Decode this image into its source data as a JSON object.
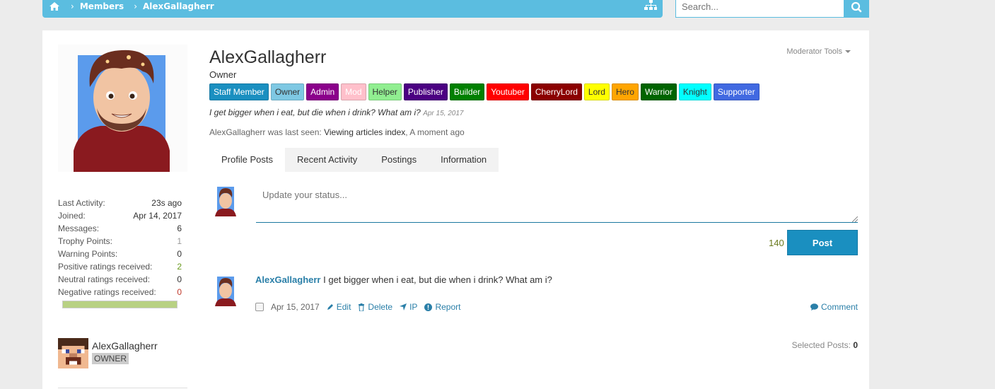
{
  "nav": {
    "breadcrumb": [
      "Members",
      "AlexGallagherr"
    ]
  },
  "search": {
    "placeholder": "Search..."
  },
  "profile": {
    "name": "AlexGallagherr",
    "title": "Owner",
    "moderator_tools": "Moderator Tools",
    "badges": [
      {
        "label": "Staff Member",
        "color": "#1a8fc0",
        "text": "#ffffff"
      },
      {
        "label": "Owner",
        "color": "#7ec8e3",
        "text": "#333333"
      },
      {
        "label": "Admin",
        "color": "#8b008b",
        "text": "#ffffff"
      },
      {
        "label": "Mod",
        "color": "#ffc0cb",
        "text": "#ffffff"
      },
      {
        "label": "Helper",
        "color": "#90ee90",
        "text": "#333333"
      },
      {
        "label": "Publisher",
        "color": "#4b0082",
        "text": "#ffffff"
      },
      {
        "label": "Builder",
        "color": "#008000",
        "text": "#ffffff"
      },
      {
        "label": "Youtuber",
        "color": "#ff0000",
        "text": "#ffffff"
      },
      {
        "label": "CherryLord",
        "color": "#8b0000",
        "text": "#ffffff"
      },
      {
        "label": "Lord",
        "color": "#ffff00",
        "text": "#333333"
      },
      {
        "label": "Hero",
        "color": "#ffa500",
        "text": "#333333"
      },
      {
        "label": "Warrior",
        "color": "#006400",
        "text": "#ffffff"
      },
      {
        "label": "Knight",
        "color": "#00ffff",
        "text": "#333333"
      },
      {
        "label": "Supporter",
        "color": "#4169e1",
        "text": "#ffffff"
      }
    ],
    "status": "I get bigger when i eat, but die when i drink? What am i?",
    "status_date": "Apr 15, 2017",
    "last_seen_prefix": "AlexGallagherr was last seen:",
    "last_seen_activity": "Viewing articles index",
    "last_seen_time": "A moment ago"
  },
  "tabs": [
    "Profile Posts",
    "Recent Activity",
    "Postings",
    "Information"
  ],
  "stats": [
    {
      "label": "Last Activity:",
      "value": "23s ago",
      "style": ""
    },
    {
      "label": "Joined:",
      "value": "Apr 14, 2017",
      "style": ""
    },
    {
      "label": "Messages:",
      "value": "6",
      "style": ""
    },
    {
      "label": "Trophy Points:",
      "value": "1",
      "style": "muted"
    },
    {
      "label": "Warning Points:",
      "value": "0",
      "style": ""
    },
    {
      "label": "Positive ratings received:",
      "value": "2",
      "style": "pos"
    },
    {
      "label": "Neutral ratings received:",
      "value": "0",
      "style": ""
    },
    {
      "label": "Negative ratings received:",
      "value": "0",
      "style": "neg"
    }
  ],
  "mini_user": {
    "name": "AlexGallagherr",
    "rank": "OWNER"
  },
  "status_box": {
    "placeholder": "Update your status...",
    "counter": "140",
    "post_label": "Post"
  },
  "post": {
    "author": "AlexGallagherr",
    "text": "I get bigger when i eat, but die when i drink? What am i?",
    "date": "Apr 15, 2017",
    "edit": "Edit",
    "delete": "Delete",
    "ip": "IP",
    "report": "Report",
    "comment": "Comment"
  },
  "selected_posts": {
    "label": "Selected Posts:",
    "count": "0"
  },
  "colors": {
    "accent": "#5bbde0",
    "link": "#2a7fa8",
    "button": "#1a8fc0"
  }
}
